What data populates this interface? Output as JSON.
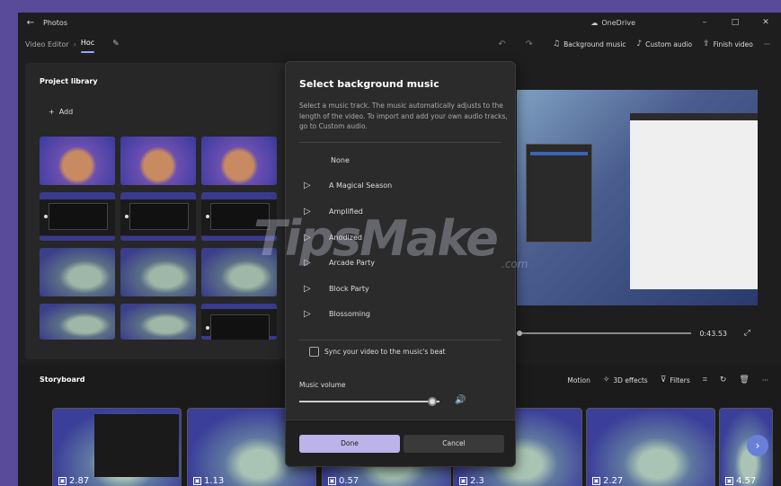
{
  "window": {
    "app_title": "Photos",
    "onedrive_label": "OneDrive",
    "minimize": "–",
    "maximize": "□",
    "close": "✕"
  },
  "toolbar": {
    "breadcrumb_parent": "Video Editor",
    "breadcrumb_sep": "›",
    "breadcrumb_current": "Hoc",
    "background_music": "Background music",
    "custom_audio": "Custom audio",
    "finish_video": "Finish video",
    "more": "···"
  },
  "library": {
    "title": "Project library",
    "add_label": "Add"
  },
  "preview": {
    "time": "0:43.53"
  },
  "storyboard": {
    "title": "Storyboard",
    "motion": "Motion",
    "effects_3d": "3D effects",
    "filters": "Filters",
    "more": "···",
    "clips": [
      {
        "duration": "2.87"
      },
      {
        "duration": "1.13"
      },
      {
        "duration": "0.57"
      },
      {
        "duration": "2.3"
      },
      {
        "duration": "2.27"
      },
      {
        "duration": "4.57"
      }
    ]
  },
  "dialog": {
    "title": "Select background music",
    "description": "Select a music track. The music automatically adjusts to the length of the video. To import and add your own audio tracks, go to Custom audio.",
    "tracks": [
      {
        "name": "None"
      },
      {
        "name": "A Magical Season"
      },
      {
        "name": "Amplified"
      },
      {
        "name": "Anodized"
      },
      {
        "name": "Arcade Party"
      },
      {
        "name": "Block Party"
      },
      {
        "name": "Blossoming"
      }
    ],
    "sync_label": "Sync your video to the music's beat",
    "volume_label": "Music volume",
    "volume_level": 0.95,
    "done": "Done",
    "cancel": "Cancel"
  },
  "watermark": {
    "main": "TipsMake",
    "suffix": ".com"
  },
  "colors": {
    "accent": "#bcb3e8",
    "next_button": "#6a7fd8",
    "desktop": "#5a4a9a"
  }
}
